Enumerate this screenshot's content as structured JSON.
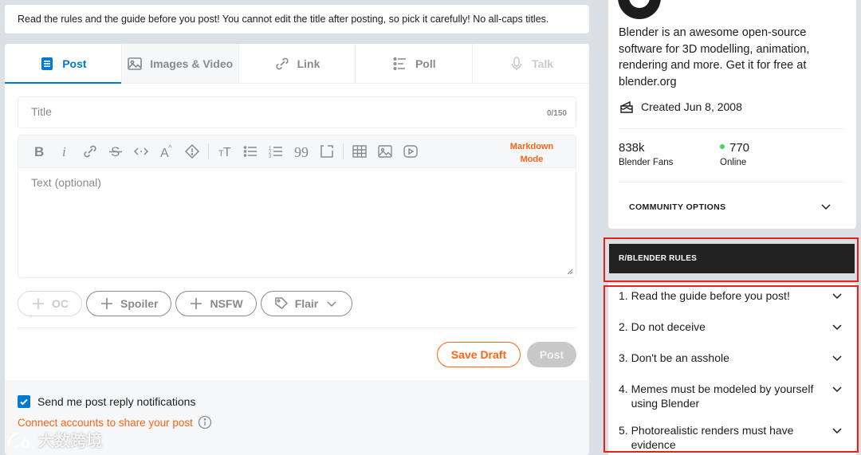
{
  "notice": "Read the rules and the guide before you post! You cannot edit the title after posting, so pick it carefully! No all-caps titles.",
  "tabs": [
    {
      "label": "Post",
      "icon": "post-icon",
      "state": "active"
    },
    {
      "label": "Images & Video",
      "icon": "image-icon",
      "state": "hover"
    },
    {
      "label": "Link",
      "icon": "link-icon",
      "state": "normal"
    },
    {
      "label": "Poll",
      "icon": "poll-icon",
      "state": "normal"
    },
    {
      "label": "Talk",
      "icon": "microphone-icon",
      "state": "disabled"
    }
  ],
  "title_field": {
    "placeholder": "Title",
    "counter": "0/150"
  },
  "editor": {
    "markdown_line1": "Markdown",
    "markdown_line2": "Mode",
    "body_placeholder": "Text (optional)"
  },
  "post_tags": {
    "oc": "OC",
    "spoiler": "Spoiler",
    "nsfw": "NSFW",
    "flair": "Flair"
  },
  "actions": {
    "save_draft": "Save Draft",
    "post": "Post"
  },
  "footer": {
    "notifications_label": "Send me post reply notifications",
    "notifications_checked": true,
    "connect_label": "Connect accounts to share your post"
  },
  "about": {
    "description": "Blender is an awesome open-source software for 3D modelling, animation, rendering and more. Get it for free at blender.org",
    "created": "Created Jun 8, 2008",
    "members_count": "838k",
    "members_label": "Blender Fans",
    "online_count": "770",
    "online_label": "Online",
    "community_options": "COMMUNITY OPTIONS"
  },
  "rules": {
    "header": "R/BLENDER RULES",
    "items": [
      {
        "number": "1.",
        "text": "Read the guide before you post!"
      },
      {
        "number": "2.",
        "text": "Do not deceive"
      },
      {
        "number": "3.",
        "text": "Don't be an asshole"
      },
      {
        "number": "4.",
        "text": "Memes must be modeled by yourself using Blender"
      },
      {
        "number": "5.",
        "text": "Photorealistic renders must have evidence"
      }
    ]
  },
  "watermark": "大数跨境",
  "colors": {
    "accent": "#0079d3",
    "orange": "#ff6314",
    "highlight": "#e2231a",
    "online": "#46d160"
  }
}
